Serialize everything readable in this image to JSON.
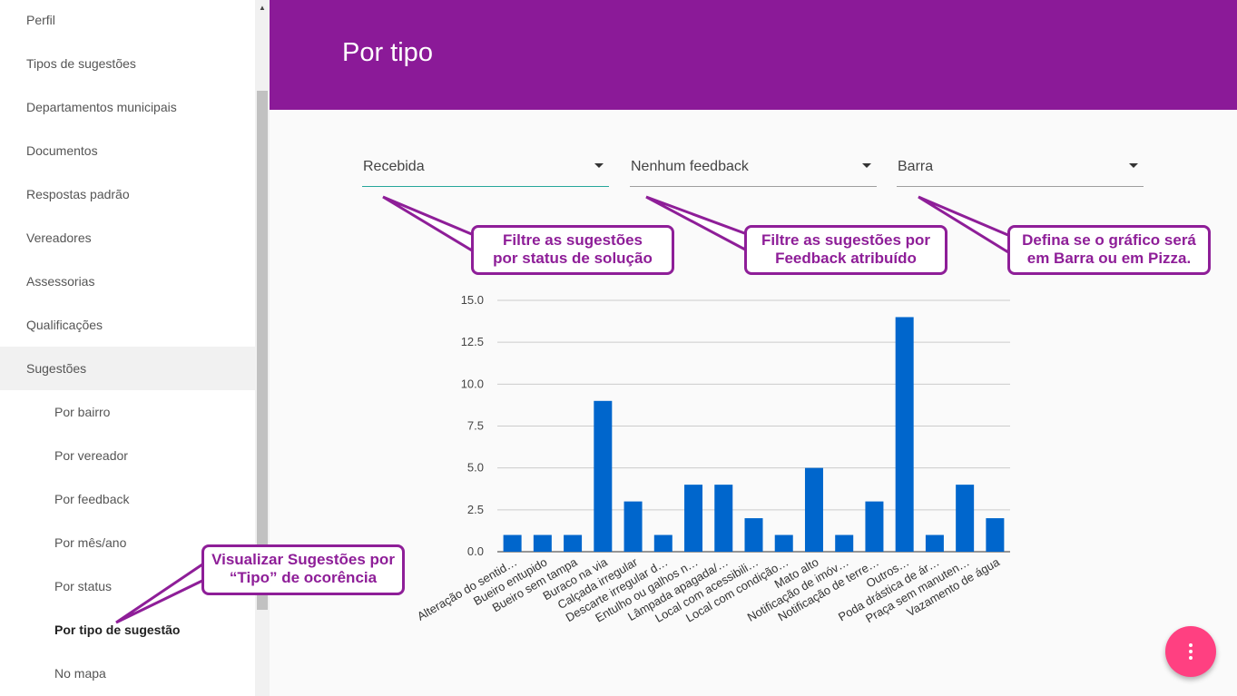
{
  "sidebar": {
    "items": [
      {
        "label": "Perfil"
      },
      {
        "label": "Tipos de sugestões"
      },
      {
        "label": "Departamentos municipais"
      },
      {
        "label": "Documentos"
      },
      {
        "label": "Respostas padrão"
      },
      {
        "label": "Vereadores"
      },
      {
        "label": "Assessorias"
      },
      {
        "label": "Qualificações"
      },
      {
        "label": "Sugestões"
      }
    ],
    "subitems": [
      {
        "label": "Por bairro"
      },
      {
        "label": "Por vereador"
      },
      {
        "label": "Por feedback"
      },
      {
        "label": "Por mês/ano"
      },
      {
        "label": "Por status"
      },
      {
        "label": "Por tipo de sugestão"
      },
      {
        "label": "No mapa"
      }
    ]
  },
  "header": {
    "title": "Por tipo",
    "color": "#8b1a98"
  },
  "filters": {
    "status": {
      "value": "Recebida"
    },
    "feedback": {
      "value": "Nenhum feedback"
    },
    "chart_type": {
      "value": "Barra"
    }
  },
  "callouts": {
    "status": {
      "line1": "Filtre as sugestões",
      "line2": "por status de solução"
    },
    "feedback": {
      "line1": "Filtre as sugestões por",
      "line2": "Feedback atribuído"
    },
    "chart_type": {
      "line1": "Defina se o gráfico será",
      "line2": "em Barra ou em Pizza."
    },
    "sidebar": {
      "line1": "Visualizar Sugestões por",
      "line2": "“Tipo” de ocorência"
    },
    "color": "#8e1e98"
  },
  "chart_data": {
    "type": "bar",
    "categories": [
      "Alteração do sentid…",
      "Bueiro entupido",
      "Bueiro sem tampa",
      "Buraco na via",
      "Calçada irregular",
      "Descarte irregular d…",
      "Entulho ou galhos n…",
      "Lâmpada apagada/…",
      "Local com acessibili…",
      "Local com condição…",
      "Mato alto",
      "Notificação de imóv…",
      "Notificação de terre…",
      "Outros…",
      "Poda drástica de ár…",
      "Praça sem manuten…",
      "Vazamento de água"
    ],
    "values": [
      1,
      1,
      1,
      9,
      3,
      1,
      4,
      4,
      2,
      1,
      5,
      1,
      3,
      14,
      1,
      4,
      2
    ],
    "yticks": [
      "0.0",
      "2.5",
      "5.0",
      "7.5",
      "10.0",
      "12.5",
      "15.0"
    ],
    "ylim": [
      0,
      15
    ],
    "grid": true,
    "bar_color": "#0066cc"
  },
  "fab": {
    "icon": "more-vert-icon",
    "color": "#ff4081"
  }
}
